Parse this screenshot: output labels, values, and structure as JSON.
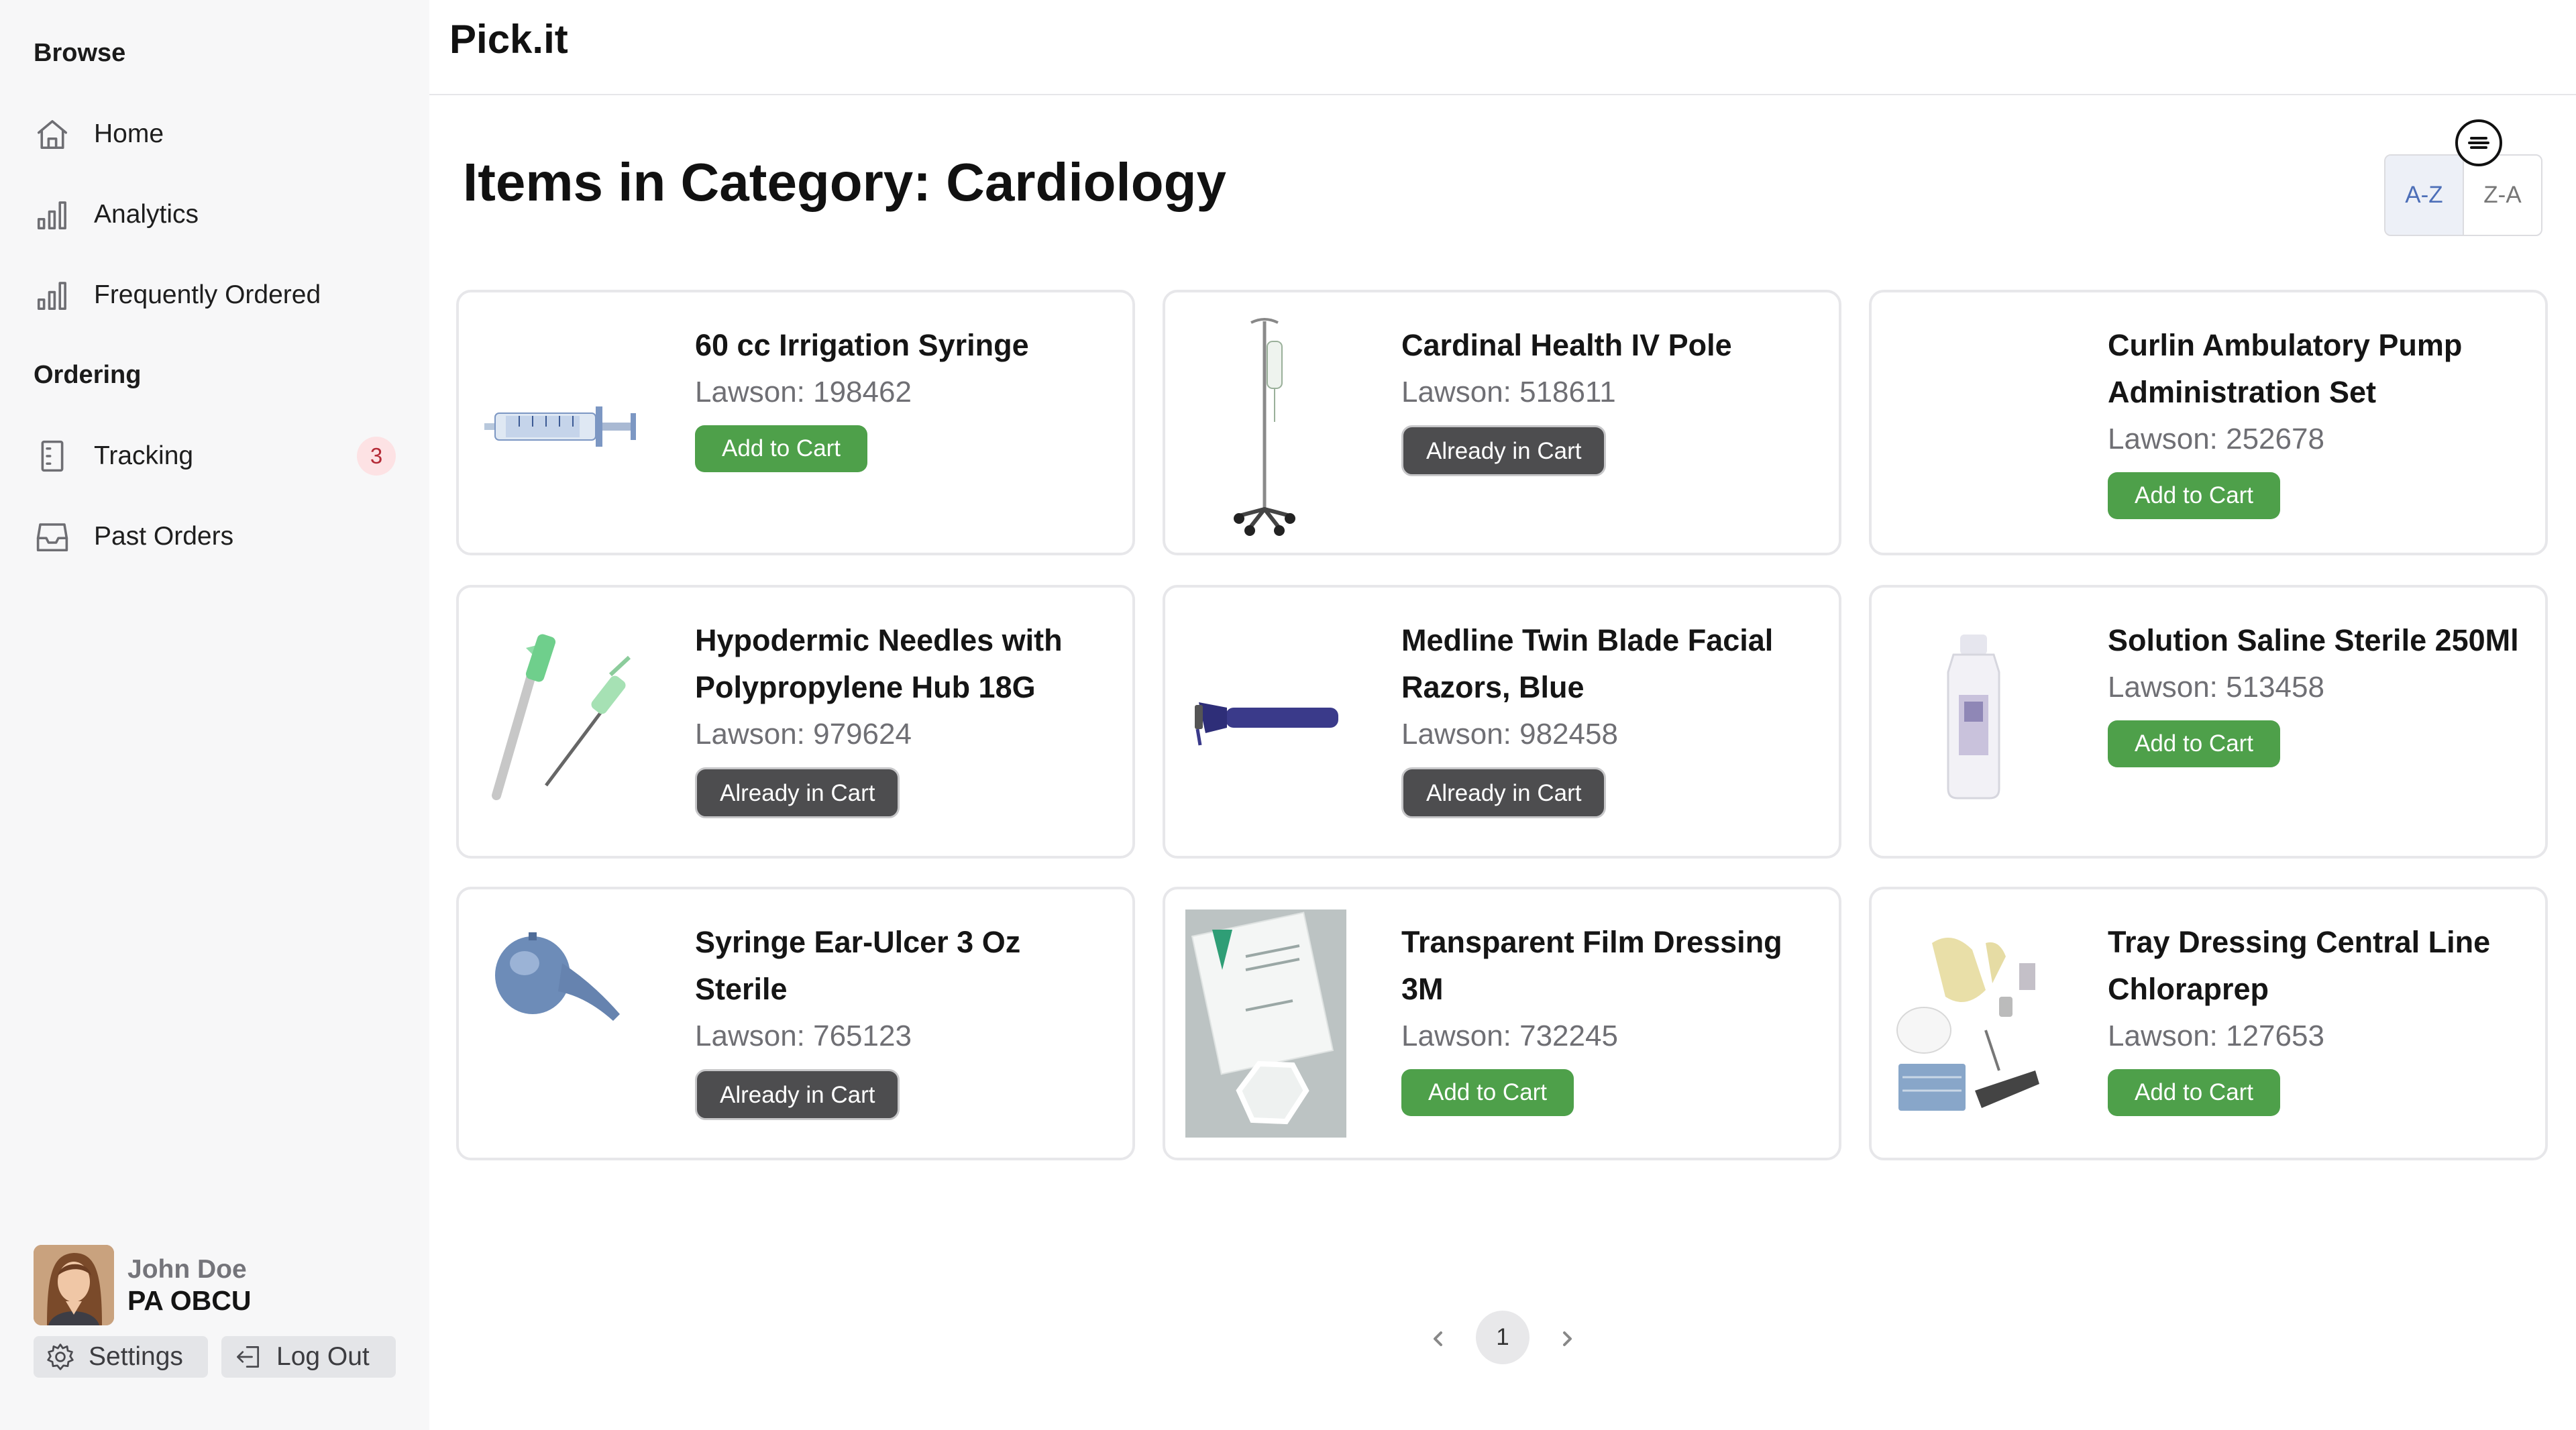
{
  "app": {
    "brand": "Pick.it"
  },
  "sidebar": {
    "sections": {
      "browse": "Browse",
      "ordering": "Ordering"
    },
    "items": [
      {
        "label": "Home",
        "icon": "home-icon"
      },
      {
        "label": "Analytics",
        "icon": "bar-chart-icon"
      },
      {
        "label": "Frequently Ordered",
        "icon": "bar-chart-icon"
      },
      {
        "label": "Tracking",
        "icon": "receipt-icon",
        "badge": "3"
      },
      {
        "label": "Past Orders",
        "icon": "inbox-icon"
      }
    ],
    "user": {
      "name": "John Doe",
      "role": "PA OBCU"
    },
    "settings_label": "Settings",
    "logout_label": "Log Out"
  },
  "main": {
    "title": "Items in Category: Cardiology",
    "sort": {
      "asc": "A-Z",
      "desc": "Z-A",
      "active": "A-Z"
    },
    "products": [
      {
        "name": "60 cc Irrigation Syringe",
        "lawson": "Lawson: 198462",
        "action": "Add to Cart",
        "in_cart": false,
        "image": "syringe"
      },
      {
        "name": "Cardinal Health IV Pole",
        "lawson": "Lawson: 518611",
        "action": "Already in Cart",
        "in_cart": true,
        "image": "iv-pole"
      },
      {
        "name": "Curlin Ambulatory Pump Administration Set",
        "lawson": "Lawson: 252678",
        "action": "Add to Cart",
        "in_cart": false,
        "image": "none"
      },
      {
        "name": "Hypodermic Needles with Polypropylene Hub 18G",
        "lawson": "Lawson: 979624",
        "action": "Already in Cart",
        "in_cart": true,
        "image": "needles"
      },
      {
        "name": "Medline Twin Blade Facial Razors, Blue",
        "lawson": "Lawson: 982458",
        "action": "Already in Cart",
        "in_cart": true,
        "image": "razor"
      },
      {
        "name": "Solution Saline Sterile 250Ml",
        "lawson": "Lawson: 513458",
        "action": "Add to Cart",
        "in_cart": false,
        "image": "saline-bottle"
      },
      {
        "name": "Syringe Ear-Ulcer 3 Oz Sterile",
        "lawson": "Lawson: 765123",
        "action": "Already in Cart",
        "in_cart": true,
        "image": "ear-bulb"
      },
      {
        "name": "Transparent Film Dressing 3M",
        "lawson": "Lawson: 732245",
        "action": "Add to Cart",
        "in_cart": false,
        "image": "film-dressing"
      },
      {
        "name": "Tray Dressing Central Line Chloraprep",
        "lawson": "Lawson: 127653",
        "action": "Add to Cart",
        "in_cart": false,
        "image": "dressing-tray"
      }
    ]
  },
  "pagination": {
    "current": "1"
  },
  "colors": {
    "add_button": "#4ea04a",
    "in_cart_button": "#4d4d4f",
    "sort_active": "#4d6fb8",
    "badge_bg": "#fde2e4",
    "badge_text": "#b42a36"
  }
}
